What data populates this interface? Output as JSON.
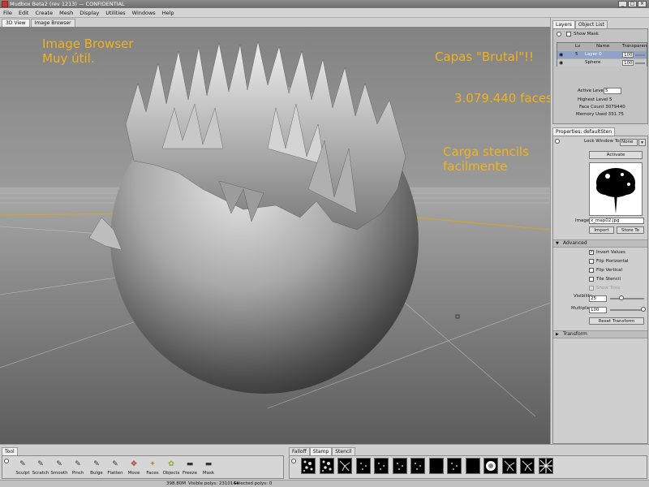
{
  "window": {
    "title": "Mudbox Beta2 (rev 1213) — CONFIDENTIAL",
    "min": "_",
    "max": "□",
    "close": "×"
  },
  "menu": [
    "File",
    "Edit",
    "Create",
    "Mesh",
    "Display",
    "Utilities",
    "Windows",
    "Help"
  ],
  "viewport_tabs": [
    "3D View",
    "Image Browser"
  ],
  "overlay": {
    "image_browser": "Image Browser\nMuy útil.",
    "capas": "Capas \"Brutal\"!!",
    "faces": "3.079.440 faces",
    "stencils": "Carga stencils\nfacilmente",
    "color": "#f2b21c"
  },
  "layers_panel": {
    "tabs": [
      "Layers",
      "Object List"
    ],
    "show_mask": "Show Mask",
    "columns": {
      "level": "Lv",
      "name": "Name",
      "transparency": "Transparenc"
    },
    "rows": [
      {
        "level": "5",
        "name": "Layer 0",
        "value": "100"
      },
      {
        "level": "",
        "name": "Sphere",
        "value": "100"
      }
    ],
    "active_level_label": "Active Level",
    "active_level": "5",
    "highest_level": "Highest Level 5",
    "face_count": "Face Count 3079440",
    "memory_used": "Memory Used 331.75"
  },
  "properties_panel": {
    "tab": "Properties: defaultSten",
    "lock_window_label": "Lock Window To",
    "lock_window_value": "None",
    "activate": "Activate",
    "image_label": "Image",
    "image_value": "x_map02.jpg",
    "import": "Import",
    "store_to": "Store To",
    "advanced": "Advanced",
    "checkboxes": [
      {
        "label": "Invert Values",
        "checked": true
      },
      {
        "label": "Flip Horizontal",
        "checked": false
      },
      {
        "label": "Flip Vertical",
        "checked": false
      },
      {
        "label": "Tile Stencil",
        "checked": false
      },
      {
        "label": "Show Tiles",
        "checked": false
      }
    ],
    "visibility_label": "Visibility",
    "visibility": "25",
    "visibility_fraction": 0.25,
    "multiplier_label": "Multiplier",
    "multiplier": "100",
    "multiplier_fraction": 1.0,
    "reset_transform": "Reset Transform",
    "transform": "Transform"
  },
  "tool_panel": {
    "label": "Tool",
    "tools": [
      {
        "name": "Sculpt",
        "icon": "sculpt-icon",
        "glyph": "✎"
      },
      {
        "name": "Scratch",
        "icon": "scratch-icon",
        "glyph": "✎"
      },
      {
        "name": "Smooth",
        "icon": "smooth-icon",
        "glyph": "✎"
      },
      {
        "name": "Pinch",
        "icon": "pinch-icon",
        "glyph": "✎"
      },
      {
        "name": "Bulge",
        "icon": "bulge-icon",
        "glyph": "✎"
      },
      {
        "name": "Flatten",
        "icon": "flatten-icon",
        "glyph": "✎"
      },
      {
        "name": "Move",
        "icon": "move-icon",
        "glyph": "✥"
      },
      {
        "name": "Faces",
        "icon": "faces-icon",
        "glyph": "✦"
      },
      {
        "name": "Objects",
        "icon": "objects-icon",
        "glyph": "✿"
      },
      {
        "name": "Freeze",
        "icon": "freeze-icon",
        "glyph": "▬"
      },
      {
        "name": "Mask",
        "icon": "mask-icon",
        "glyph": "▬"
      }
    ]
  },
  "stamp_panel": {
    "tabs": [
      "Falloff",
      "Stamp",
      "Stencil"
    ]
  },
  "status": {
    "memory": "398.80M",
    "visible": "Visible polys: 2310144",
    "selected": "Selected polys: 0"
  }
}
